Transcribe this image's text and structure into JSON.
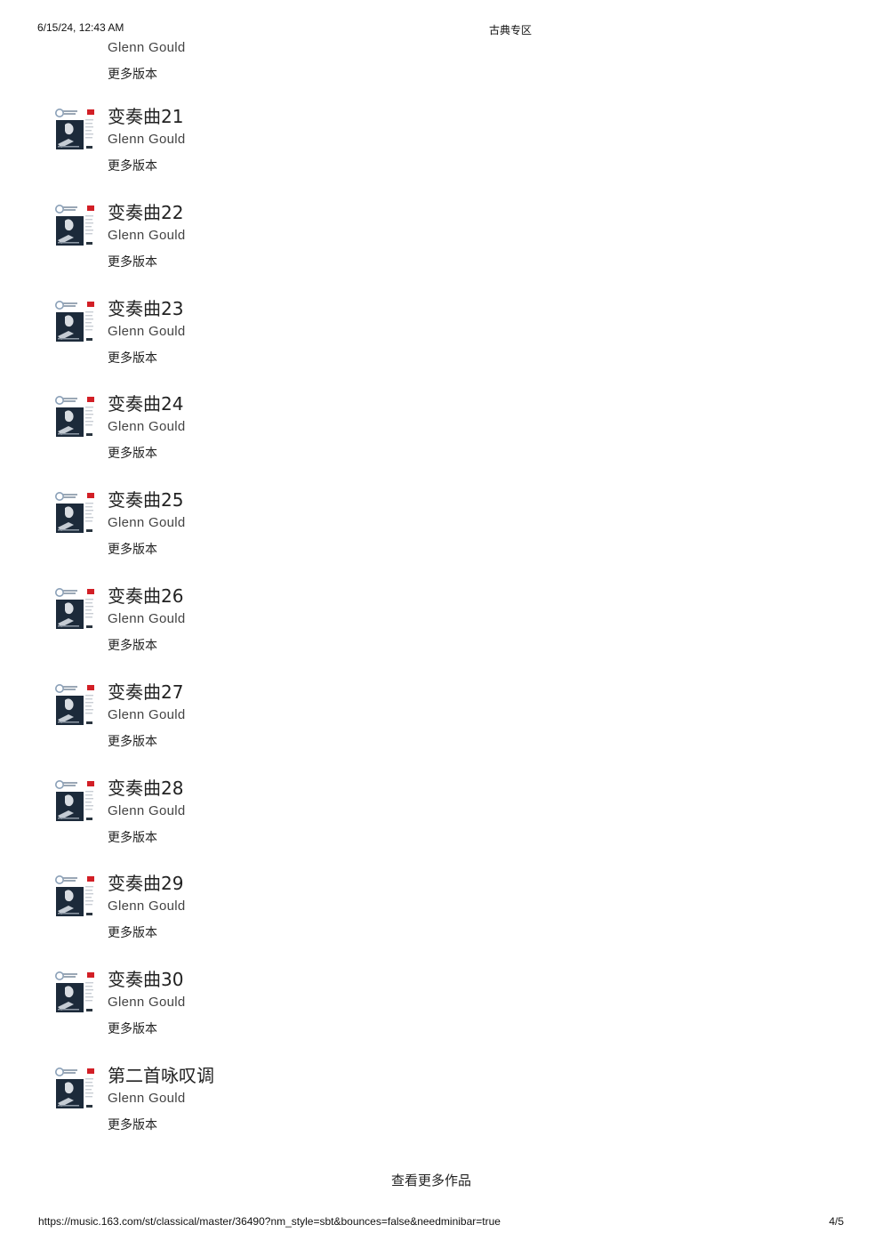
{
  "print_header": {
    "datetime": "6/15/24, 12:43 AM",
    "page_title": "古典专区"
  },
  "partial_item": {
    "artist": "Glenn Gould",
    "more_versions": "更多版本"
  },
  "tracks": [
    {
      "title": "变奏曲21",
      "artist": "Glenn Gould",
      "more_versions": "更多版本"
    },
    {
      "title": "变奏曲22",
      "artist": "Glenn Gould",
      "more_versions": "更多版本"
    },
    {
      "title": "变奏曲23",
      "artist": "Glenn Gould",
      "more_versions": "更多版本"
    },
    {
      "title": "变奏曲24",
      "artist": "Glenn Gould",
      "more_versions": "更多版本"
    },
    {
      "title": "变奏曲25",
      "artist": "Glenn Gould",
      "more_versions": "更多版本"
    },
    {
      "title": "变奏曲26",
      "artist": "Glenn Gould",
      "more_versions": "更多版本"
    },
    {
      "title": "变奏曲27",
      "artist": "Glenn Gould",
      "more_versions": "更多版本"
    },
    {
      "title": "变奏曲28",
      "artist": "Glenn Gould",
      "more_versions": "更多版本"
    },
    {
      "title": "变奏曲29",
      "artist": "Glenn Gould",
      "more_versions": "更多版本"
    },
    {
      "title": "变奏曲30",
      "artist": "Glenn Gould",
      "more_versions": "更多版本"
    },
    {
      "title": "第二首咏叹调",
      "artist": "Glenn Gould",
      "more_versions": "更多版本"
    }
  ],
  "view_more": "查看更多作品",
  "print_footer": {
    "url": "https://music.163.com/st/classical/master/36490?nm_style=sbt&bounces=false&needminibar=true",
    "page_number": "4/5"
  },
  "colors": {
    "text_primary": "#222222",
    "text_secondary": "#444444",
    "cover_dark": "#1c2a3a",
    "cover_accent": "#d21f26"
  },
  "icons": {
    "cover": "album-cover-icon"
  }
}
